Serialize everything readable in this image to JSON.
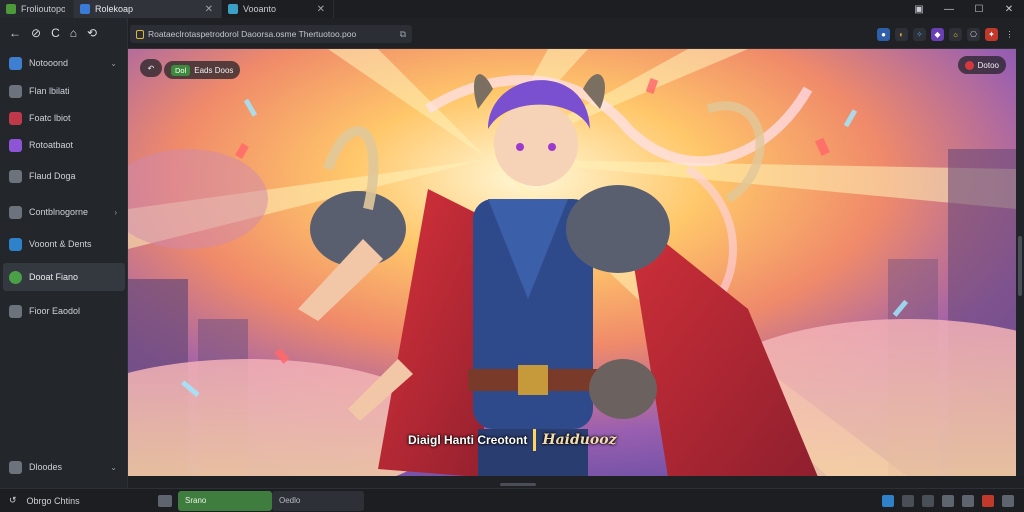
{
  "tabs": [
    {
      "label": "Frolioutopo",
      "color": "#4c9a3a"
    },
    {
      "label": "Rolekoap",
      "color": "#3b7bd8"
    },
    {
      "label": "Vooanto",
      "color": "#3aa0c8"
    }
  ],
  "window_controls": [
    "▣",
    "—",
    "☐",
    "✕"
  ],
  "address": {
    "url": "Roataeclrotaspetrodorol Daoorsa.osme Thertuotoo.poo"
  },
  "nav_controls": [
    "←",
    "⊘",
    "C",
    "⌂",
    "⟲"
  ],
  "sidebar": {
    "items": [
      {
        "label": "Notooond",
        "color": "#3f7fd1",
        "chevron": "⌄"
      },
      {
        "label": "Flan lbilati",
        "color": "#8a8f98"
      },
      {
        "label": "Foatc lbiot",
        "color": "#c0394b"
      },
      {
        "label": "Rotoatbaot",
        "color": "#8e54d6"
      },
      {
        "label": "Flaud Doga",
        "color": "#8a8f98"
      },
      {
        "label": "Contblnogorne",
        "color": "#8a8f98",
        "chevron": "›"
      },
      {
        "label": "Vooont & Dents",
        "color": "#2f82c9"
      },
      {
        "label": "Dooat Fiano",
        "color": "#49a046"
      },
      {
        "label": "Fioor Eaodol",
        "color": "#8a8f98"
      }
    ],
    "footer_item": {
      "label": "Dloodes",
      "color": "#8a8f98",
      "chevron": "⌄"
    }
  },
  "overlay": {
    "back_icon": "↶",
    "badge_label": "Eads Doos",
    "badge_pill": "Dol",
    "right_button": "Dotoo"
  },
  "caption": {
    "text": "Diaigl Hanti Creotont",
    "brand": "Haiduooz"
  },
  "bottom": {
    "left_label": "Obrgo Chtins",
    "field_green": "Srano",
    "field_dark": "Oedlo"
  },
  "accent_colors": {
    "green": "#3f7d3e",
    "tab_active": "#30343a",
    "sidebar_bg": "#23262b"
  }
}
